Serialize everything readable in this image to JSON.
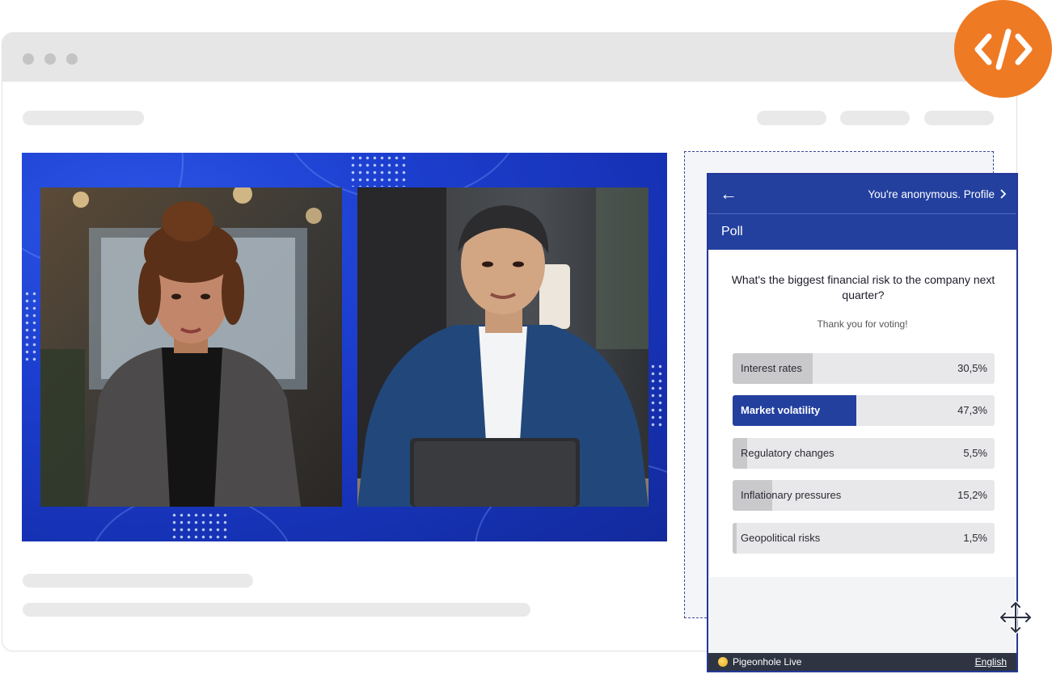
{
  "widget": {
    "header": {
      "back_icon": "arrow-left-icon",
      "anon_text": "You're anonymous. Profile",
      "chevron_icon": "chevron-right-icon"
    },
    "section_title": "Poll",
    "poll": {
      "question": "What's the biggest financial risk to the company next quarter?",
      "status": "Thank you for voting!",
      "options": [
        {
          "label": "Interest rates",
          "percent_text": "30,5%",
          "value": 30.5,
          "selected": false
        },
        {
          "label": "Market volatility",
          "percent_text": "47,3%",
          "value": 47.3,
          "selected": true
        },
        {
          "label": "Regulatory changes",
          "percent_text": "5,5%",
          "value": 5.5,
          "selected": false
        },
        {
          "label": "Inflationary pressures",
          "percent_text": "15,2%",
          "value": 15.2,
          "selected": false
        },
        {
          "label": "Geopolitical risks",
          "percent_text": "1,5%",
          "value": 1.5,
          "selected": false
        }
      ]
    },
    "footer": {
      "brand": "Pigeonhole Live",
      "language": "English"
    }
  },
  "colors": {
    "accent": "#23409f",
    "badge": "#ef7a24",
    "video_bg": "#1d3fd0"
  },
  "icons": {
    "badge": "code-icon",
    "move": "move-icon"
  }
}
